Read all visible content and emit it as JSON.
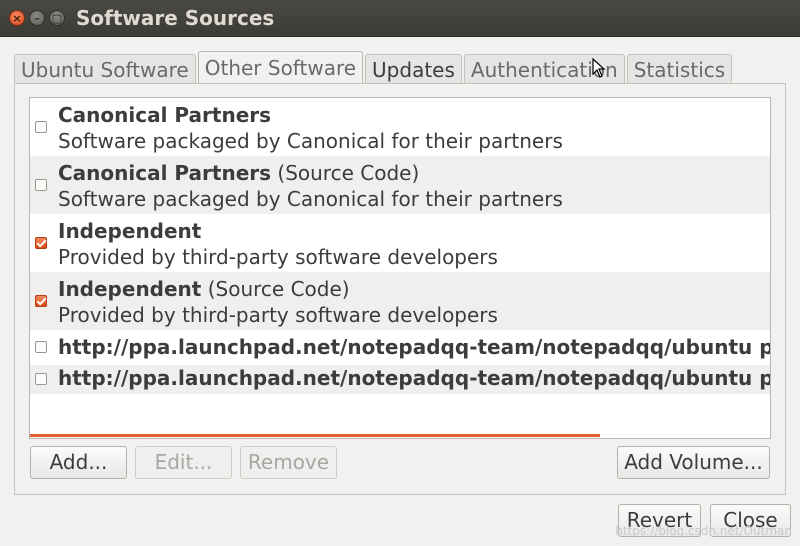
{
  "window": {
    "title": "Software Sources",
    "close_glyph": "×",
    "min_glyph": "–",
    "max_glyph": "□"
  },
  "tabs": [
    {
      "label": "Ubuntu Software"
    },
    {
      "label": "Other Software"
    },
    {
      "label": "Updates"
    },
    {
      "label": "Authentication"
    },
    {
      "label": "Statistics"
    }
  ],
  "sources": [
    {
      "title": "Canonical Partners",
      "suffix": "",
      "desc": "Software packaged by Canonical for their partners",
      "checked": false
    },
    {
      "title": "Canonical Partners",
      "suffix": " (Source Code)",
      "desc": "Software packaged by Canonical for their partners",
      "checked": false
    },
    {
      "title": "Independent",
      "suffix": "",
      "desc": "Provided by third-party software developers",
      "checked": true
    },
    {
      "title": "Independent",
      "suffix": " (Source Code)",
      "desc": "Provided by third-party software developers",
      "checked": true
    },
    {
      "title": "http://ppa.launchpad.net/notepadqq-team/notepadqq/ubuntu precise main",
      "checked": false
    },
    {
      "title": "http://ppa.launchpad.net/notepadqq-team/notepadqq/ubuntu precise main",
      "checked": false
    }
  ],
  "buttons": {
    "add": "Add...",
    "edit": "Edit...",
    "remove": "Remove",
    "add_volume": "Add Volume...",
    "revert": "Revert",
    "close": "Close"
  },
  "watermark": "https://blog.csdn.net/Outman",
  "colors": {
    "accent": "#dd4814",
    "titlebar": "#3c3b37"
  }
}
